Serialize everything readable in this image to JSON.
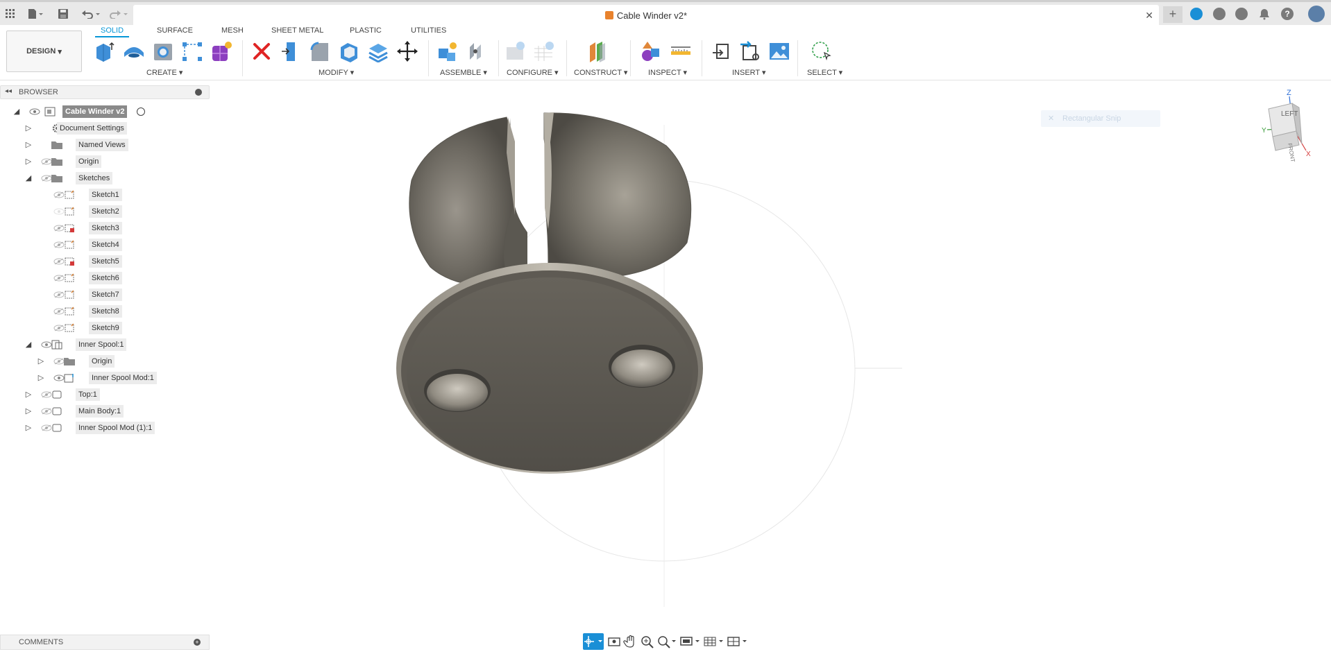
{
  "titlebar": {
    "document_title": "Cable Winder v2*",
    "close_glyph": "✕",
    "new_tab_glyph": "+"
  },
  "ribbon": {
    "workspace": "DESIGN",
    "tabs": [
      {
        "label": "SOLID",
        "active": true
      },
      {
        "label": "SURFACE",
        "active": false
      },
      {
        "label": "MESH",
        "active": false
      },
      {
        "label": "SHEET METAL",
        "active": false
      },
      {
        "label": "PLASTIC",
        "active": false
      },
      {
        "label": "UTILITIES",
        "active": false
      }
    ],
    "groups": [
      "CREATE ▾",
      "MODIFY ▾",
      "ASSEMBLE ▾",
      "CONFIGURE ▾",
      "CONSTRUCT ▾",
      "INSPECT ▾",
      "INSERT ▾",
      "SELECT ▾"
    ]
  },
  "browser": {
    "title": "BROWSER",
    "root": "Cable Winder v2",
    "items": [
      "Document Settings",
      "Named Views",
      "Origin",
      "Sketches",
      "Sketch1",
      "Sketch2",
      "Sketch3",
      "Sketch4",
      "Sketch5",
      "Sketch6",
      "Sketch7",
      "Sketch8",
      "Sketch9",
      "Inner Spool:1",
      "Origin",
      "Inner Spool Mod:1",
      "Top:1",
      "Main Body:1",
      "Inner Spool Mod (1):1"
    ]
  },
  "viewport": {
    "snip_tooltip": "Rectangular Snip",
    "viewcube": {
      "face": "LEFT",
      "side_face": "FRONT",
      "axis_z": "Z",
      "axis_y": "Y",
      "axis_x": "X"
    }
  },
  "comments": {
    "title": "COMMENTS"
  },
  "colors": {
    "accent": "#0696d7",
    "model": "#5e5a53"
  }
}
